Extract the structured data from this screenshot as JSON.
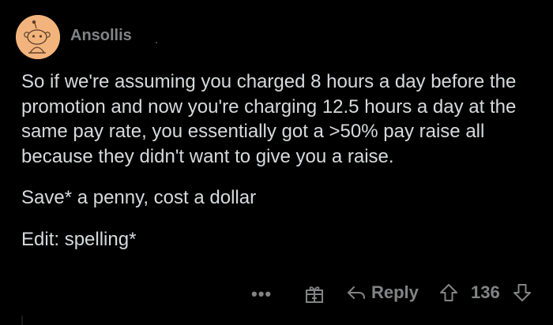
{
  "comment": {
    "username": "Ansollis",
    "paragraphs": [
      "So if we're assuming you charged 8 hours a day before the promotion and now you're charging 12.5 hours a day at the same pay rate, you essentially got a >50% pay raise all because they didn't want to give you a raise.",
      "Save* a penny, cost a dollar",
      "Edit: spelling*"
    ]
  },
  "actions": {
    "more_label": "•••",
    "award_icon": "gift-icon",
    "reply_label": "Reply",
    "score": "136"
  },
  "colors": {
    "background": "#000000",
    "text": "#d7dadc",
    "muted": "#818384",
    "avatar_bg": "#f2b47c"
  }
}
